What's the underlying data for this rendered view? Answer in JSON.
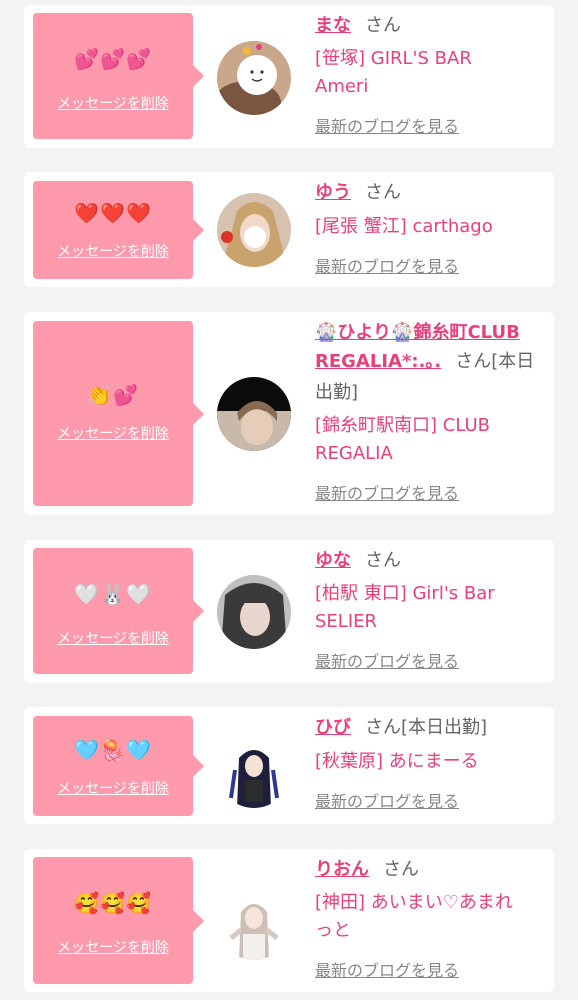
{
  "delete_label": "メッセージを削除",
  "blog_label": "最新のブログを見る",
  "san_label": "さん",
  "colors": {
    "page_bg": "#f3f3f3",
    "bubble_bg": "#ff9aac",
    "accent_pink": "#e6417a",
    "muted_text": "#888888"
  },
  "cards": [
    {
      "emojis": "💕💕💕",
      "name": "まな",
      "san": "さん",
      "extra": "",
      "store": [
        "[笹塚] GIRL'S BAR",
        "Ameri"
      ]
    },
    {
      "emojis": "❤️❤️❤️",
      "name": "ゆう",
      "san": "さん",
      "extra": "",
      "store": [
        "[尾張 蟹江] carthago"
      ]
    },
    {
      "emojis": "👏💕",
      "name_lines": [
        "🎡ひより🎡錦糸町CLUB",
        "REGALIA*:.｡."
      ],
      "san": "さん",
      "extra": "[本日",
      "extra2": "出勤]",
      "store": [
        "[錦糸町駅南口] CLUB",
        "REGALIA"
      ]
    },
    {
      "emojis": "🤍🐰🤍",
      "name": "ゆな",
      "san": "さん",
      "extra": "",
      "store": [
        "[柏駅 東口] Girl's Bar",
        "SELIER"
      ]
    },
    {
      "emojis": "🩵🪼🩵",
      "name": "ひび",
      "san": "さん",
      "extra": "[本日出勤]",
      "store": [
        "[秋葉原] あにまーる"
      ]
    },
    {
      "emojis": "🥰🥰🥰",
      "name": "りおん",
      "san": "さん",
      "extra": "",
      "store": [
        "[神田] あいまい♡あまれ",
        "っと"
      ]
    }
  ]
}
